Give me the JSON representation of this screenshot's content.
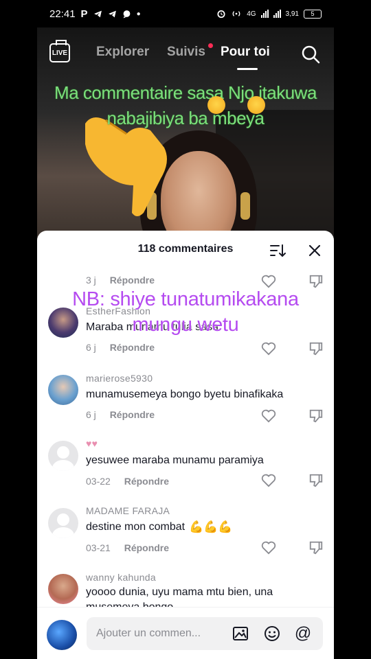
{
  "status_bar": {
    "time": "22:41",
    "left_icons": [
      "P",
      "telegram-icon",
      "telegram-icon",
      "chat-icon",
      "dot"
    ],
    "network": "4G",
    "speed": "3,91",
    "battery": "5"
  },
  "top_nav": {
    "live_label": "LIVE",
    "tabs": [
      "Explorer",
      "Suivis",
      "Pour toi"
    ],
    "active_tab": "Pour toi"
  },
  "overlay_green": "Ma commentaire sasa Njo itakuwa nabajibiya ba mbeya",
  "overlay_purple": "NB: shiye tunatumikakana mungu wetu",
  "comments_sheet": {
    "title": "118 commentaires",
    "reply_label": "Répondre",
    "comments": [
      {
        "username": "",
        "text": "",
        "time": "3 j"
      },
      {
        "username": "EstherFashion",
        "text": "Maraba munamu tulia sasa",
        "time": "6 j"
      },
      {
        "username": "marierose5930",
        "text": "munamusemeya bongo byetu binafikaka",
        "time": "6 j"
      },
      {
        "username": "",
        "text": "yesuwee maraba munamu paramiya",
        "time": "03-22"
      },
      {
        "username": "MADAME FARAJA",
        "text": "destine mon combat",
        "time": "03-21"
      },
      {
        "username": "wanny kahunda",
        "text": "yoooo dunia, uyu mama mtu bien, una",
        "text2": "musemeya bongo",
        "time": ""
      }
    ]
  },
  "input_bar": {
    "placeholder": "Ajouter un commen..."
  },
  "colors": {
    "overlay_green": "#7be07b",
    "overlay_purple": "#b54bf0",
    "notification_dot": "#fe2c55",
    "text_primary": "#161823",
    "text_secondary": "#8a8b91"
  }
}
